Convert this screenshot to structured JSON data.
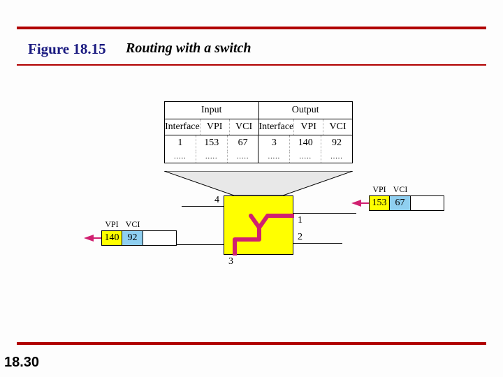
{
  "figure": {
    "label": "Figure 18.15",
    "caption": "Routing with a switch"
  },
  "page": "18.30",
  "table": {
    "io": {
      "in": "Input",
      "out": "Output"
    },
    "cols": [
      "Interface",
      "VPI",
      "VCI",
      "Interface",
      "VPI",
      "VCI"
    ],
    "row": [
      "1",
      "153",
      "67",
      "3",
      "140",
      "92"
    ],
    "dots": "....."
  },
  "ports": {
    "p1": "1",
    "p2": "2",
    "p3": "3",
    "p4": "4"
  },
  "cell_labels": {
    "vpi": "VPI",
    "vci": "VCI"
  },
  "in_cell": {
    "vpi": "153",
    "vci": "67"
  },
  "out_cell": {
    "vpi": "140",
    "vci": "92"
  }
}
